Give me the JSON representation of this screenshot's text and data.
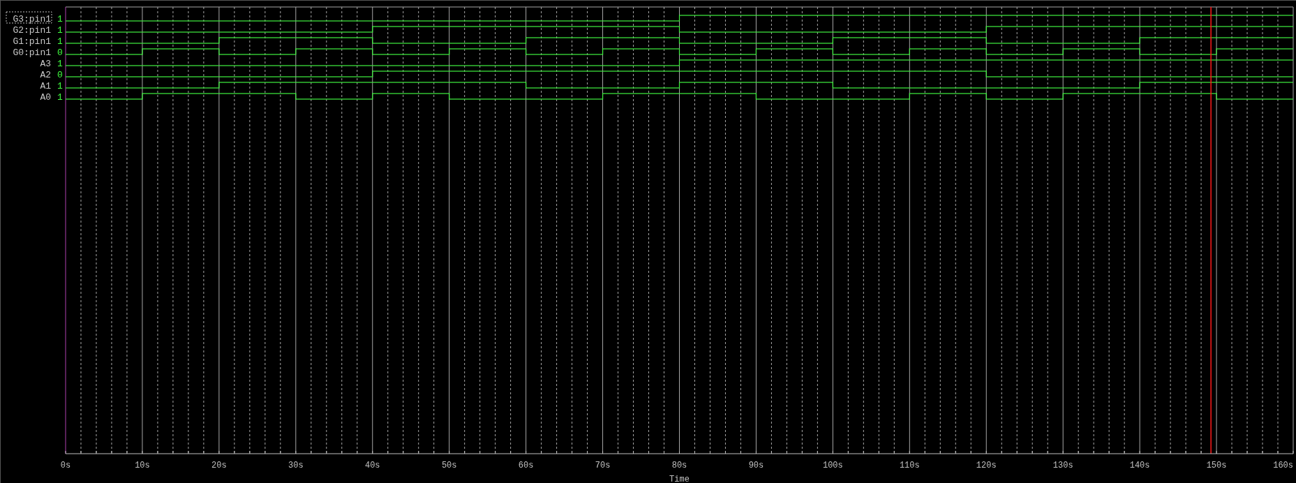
{
  "signals": [
    {
      "name": "G3:pin1",
      "reading": "1",
      "selected": true,
      "high": [
        false,
        false,
        false,
        false,
        false,
        false,
        false,
        false,
        true,
        true,
        true,
        true,
        true,
        true,
        true,
        true
      ]
    },
    {
      "name": "G2:pin1",
      "reading": "1",
      "selected": false,
      "high": [
        false,
        false,
        false,
        false,
        true,
        true,
        true,
        true,
        false,
        false,
        false,
        false,
        true,
        true,
        true,
        true
      ]
    },
    {
      "name": "G1:pin1",
      "reading": "1",
      "selected": false,
      "high": [
        false,
        false,
        true,
        true,
        false,
        false,
        true,
        true,
        false,
        false,
        true,
        true,
        false,
        false,
        true,
        true
      ]
    },
    {
      "name": "G0:pin1",
      "reading": "0",
      "selected": false,
      "high": [
        false,
        true,
        false,
        true,
        false,
        true,
        false,
        true,
        false,
        true,
        false,
        true,
        false,
        true,
        false,
        true
      ]
    },
    {
      "name": "A3",
      "reading": "1",
      "selected": false,
      "high": [
        false,
        false,
        false,
        false,
        false,
        false,
        false,
        false,
        true,
        true,
        true,
        true,
        true,
        true,
        true,
        true
      ]
    },
    {
      "name": "A2",
      "reading": "0",
      "selected": false,
      "high": [
        false,
        false,
        false,
        false,
        true,
        true,
        true,
        true,
        true,
        true,
        true,
        true,
        false,
        false,
        false,
        false
      ]
    },
    {
      "name": "A1",
      "reading": "1",
      "selected": false,
      "high": [
        false,
        false,
        true,
        true,
        true,
        true,
        false,
        false,
        true,
        true,
        false,
        false,
        false,
        false,
        true,
        true
      ]
    },
    {
      "name": "A0",
      "reading": "1",
      "selected": false,
      "high": [
        false,
        true,
        true,
        false,
        true,
        false,
        false,
        true,
        true,
        false,
        false,
        true,
        false,
        true,
        true,
        false
      ]
    }
  ],
  "cursor": {
    "level": 0.933
  },
  "time_axis": {
    "ticks": [
      "0s",
      "10s",
      "20s",
      "30s",
      "40s",
      "50s",
      "60s",
      "70s",
      "80s",
      "90s",
      "100s",
      "110s",
      "120s",
      "130s",
      "140s",
      "150s",
      "160s"
    ],
    "title": "Time"
  }
}
